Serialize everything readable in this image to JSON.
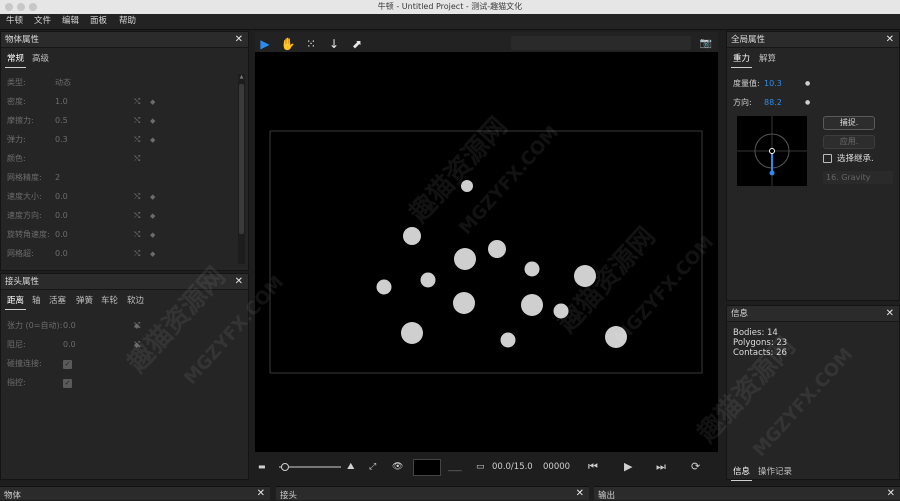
{
  "window": {
    "title": "牛顿 - Untitled Project - 测试-趣猫文化"
  },
  "menu": [
    "牛顿",
    "文件",
    "编辑",
    "面板",
    "帮助"
  ],
  "object_panel": {
    "title": "物体属性",
    "tabs": [
      "常规",
      "高级"
    ],
    "rows": [
      {
        "label": "类型:",
        "value": "动态"
      },
      {
        "label": "密度:",
        "value": "1.0"
      },
      {
        "label": "摩擦力:",
        "value": "0.5"
      },
      {
        "label": "弹力:",
        "value": "0.3"
      },
      {
        "label": "颜色:",
        "value": ""
      },
      {
        "label": "网格精度:",
        "value": "2"
      },
      {
        "label": "速度大小:",
        "value": "0.0"
      },
      {
        "label": "速度方向:",
        "value": "0.0"
      },
      {
        "label": "旋转角速度:",
        "value": "0.0"
      },
      {
        "label": "网格超:",
        "value": "0.0"
      }
    ]
  },
  "joint_panel": {
    "title": "接头属性",
    "tabs": [
      "距离",
      "轴",
      "活塞",
      "弹簧",
      "车轮",
      "软边"
    ],
    "rows": [
      {
        "label": "张力 (0=自动):",
        "value": "0.0"
      },
      {
        "label": "阻尼:",
        "value": "0.0"
      },
      {
        "label": "碰撞连接:",
        "value": ""
      },
      {
        "label": "指控:",
        "value": ""
      }
    ]
  },
  "global_panel": {
    "title": "全局属性",
    "tabs": [
      "重力",
      "解算"
    ],
    "gravity_label": "度量值:",
    "gravity_value": "10.3",
    "direction_label": "方向:",
    "direction_value": "88.2",
    "capture_button": "捕捉.",
    "apply_button": "应用.",
    "inherit_label": "选择继承.",
    "preset_value": "16. Gravity"
  },
  "info_panel": {
    "title": "信息",
    "bodies": "Bodies: 14",
    "polygons": "Polygons: 23",
    "contacts": "Contacts: 26",
    "tabs": [
      "信息",
      "操作记录"
    ]
  },
  "transport": {
    "time": "00.0/15.0",
    "frame": "00000"
  },
  "bottom_panels": [
    "物体",
    "接头",
    "输出"
  ],
  "watermark": {
    "cn": "趣猫资源网",
    "en": "MGZYFX.COM"
  },
  "colors": {
    "accent": "#2d8ceb",
    "ball": "#cfcfcf",
    "scene": "#000000"
  }
}
